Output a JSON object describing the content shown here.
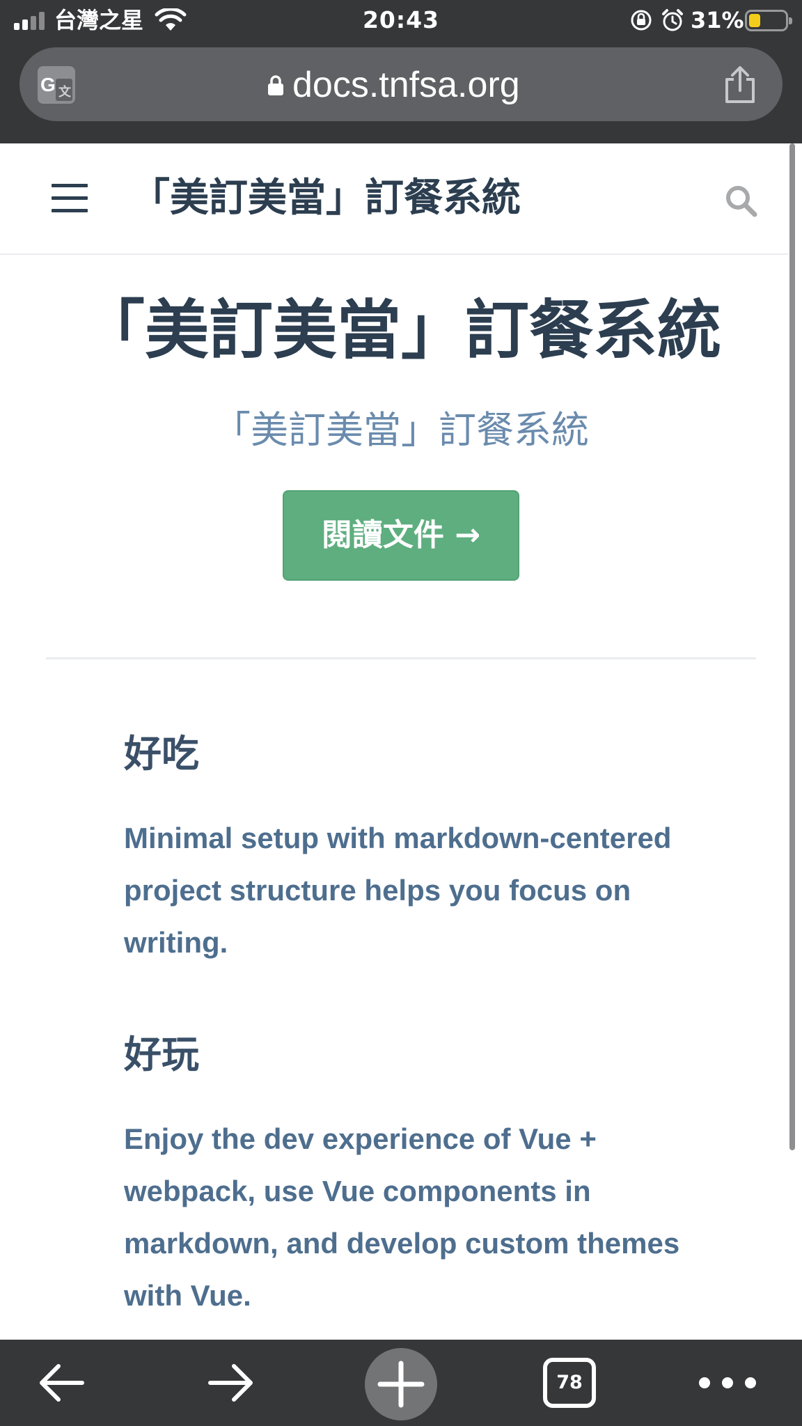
{
  "status_bar": {
    "carrier": "台灣之星",
    "time": "20:43",
    "battery_percent": "31%",
    "battery_level": 0.31,
    "battery_color": "#f3cd1c",
    "icons": [
      "signal-icon",
      "wifi-icon",
      "rotation-lock-icon",
      "alarm-icon",
      "battery-icon"
    ]
  },
  "browser": {
    "url": "docs.tnfsa.org",
    "icons": [
      "translate-icon",
      "lock-icon",
      "share-icon"
    ]
  },
  "navbar": {
    "site_title": "「美訂美當」訂餐系統",
    "icons": [
      "menu-icon",
      "search-icon"
    ]
  },
  "hero": {
    "title": "「美訂美當」訂餐系統",
    "description": "「美訂美當」訂餐系統",
    "action_label": "閱讀文件 →",
    "action_color": "#5eae7f"
  },
  "features": [
    {
      "title": "好吃",
      "details": "Minimal setup with markdown-centered project structure helps you focus on writing."
    },
    {
      "title": "好玩",
      "details": "Enjoy the dev experience of Vue + webpack, use Vue components in markdown, and develop custom themes with Vue."
    }
  ],
  "toolbar": {
    "tab_count": "78",
    "icons": [
      "back-arrow-icon",
      "forward-arrow-icon",
      "plus-icon",
      "tabs-icon",
      "more-icon"
    ]
  }
}
